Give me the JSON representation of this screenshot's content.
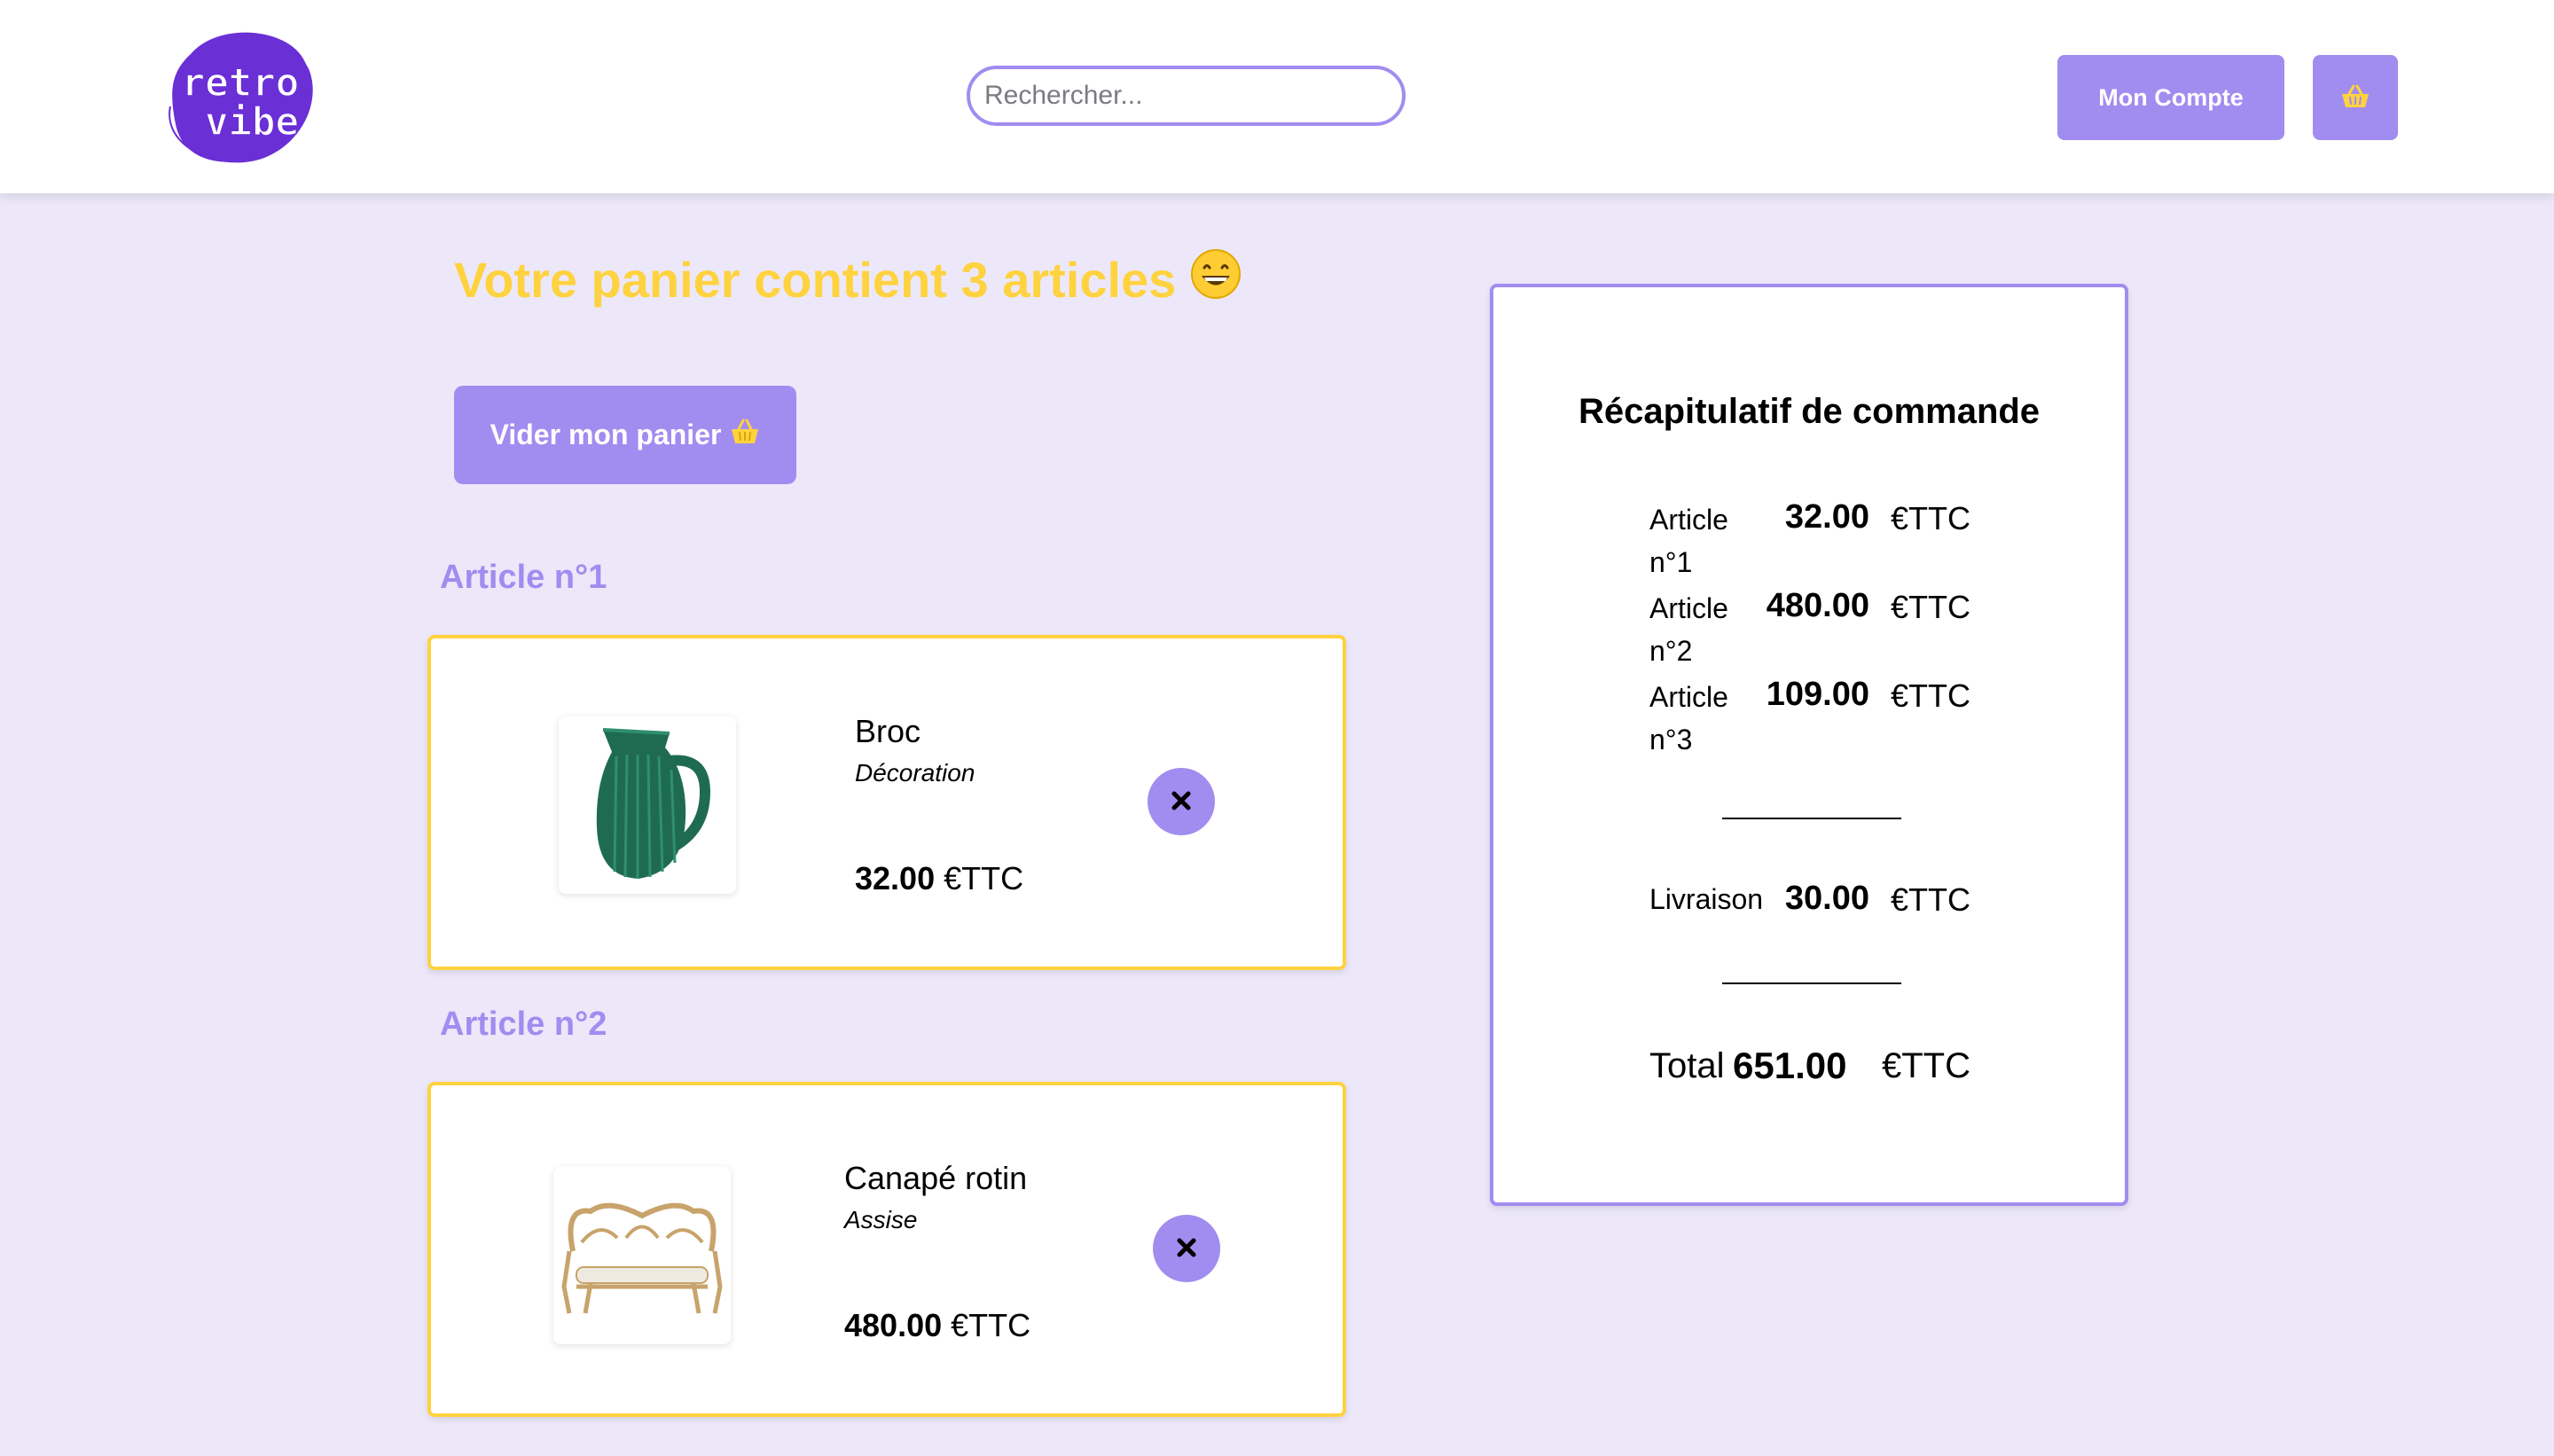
{
  "header": {
    "logo_line1": "retro",
    "logo_line2": "vibe",
    "search_placeholder": "Rechercher...",
    "account_label": "Mon Compte",
    "cart_icon": "basket-icon"
  },
  "cart": {
    "title": "Votre panier contient 3 articles",
    "title_emoji": "😄",
    "empty_label": "Vider mon panier",
    "empty_emoji": "🧺",
    "items": [
      {
        "heading": "Article n°1",
        "name": "Broc",
        "category": "Décoration",
        "price": "32.00",
        "currency": "€TTC",
        "image": "green-pitcher"
      },
      {
        "heading": "Article n°2",
        "name": "Canapé rotin",
        "category": "Assise",
        "price": "480.00",
        "currency": "€TTC",
        "image": "rattan-sofa"
      }
    ]
  },
  "summary": {
    "title": "Récapitulatif de commande",
    "lines": [
      {
        "label": "Article n°1",
        "value": "32.00",
        "currency": "€TTC"
      },
      {
        "label": "Article n°2",
        "value": "480.00",
        "currency": "€TTC"
      },
      {
        "label": "Article n°3",
        "value": "109.00",
        "currency": "€TTC"
      }
    ],
    "shipping": {
      "label": "Livraison",
      "value": "30.00",
      "currency": "€TTC"
    },
    "total": {
      "label": "Total",
      "value": "651.00",
      "currency": "€TTC"
    }
  },
  "colors": {
    "accent": "#a18cf0",
    "yellow": "#ffd23f",
    "background": "#ece8fa",
    "logo": "#6b2fd6"
  }
}
